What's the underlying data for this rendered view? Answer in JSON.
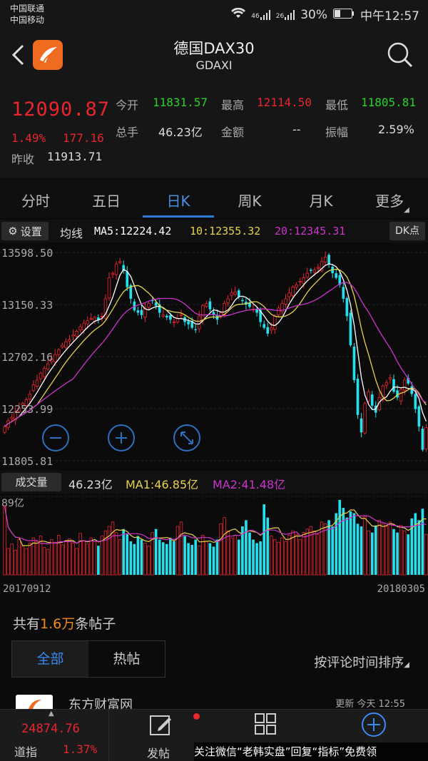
{
  "status": {
    "carrier1": "中国联通",
    "carrier2": "中国移动",
    "net1": "46",
    "net2": "26",
    "battery": "30%",
    "time": "中午12:57"
  },
  "header": {
    "title": "德国DAX30",
    "code": "GDAXI"
  },
  "quote": {
    "price": "12090.87",
    "change_pct": "1.49%",
    "change": "177.16",
    "prev_close_label": "昨收",
    "prev_close": "11913.71",
    "open_label": "今开",
    "open": "11831.57",
    "high_label": "最高",
    "high": "12114.50",
    "low_label": "最低",
    "low": "11805.81",
    "volume_label": "总手",
    "volume": "46.23亿",
    "amount_label": "金额",
    "amount": "--",
    "amplitude_label": "振幅",
    "amplitude": "2.59%"
  },
  "tabs": [
    "分时",
    "五日",
    "日K",
    "周K",
    "月K",
    "更多"
  ],
  "active_tab": "日K",
  "ma_bar": {
    "settings": "设置",
    "label": "均线",
    "ma5": "MA5:12224.42",
    "ma10": "10:12355.32",
    "ma20": "20:12345.31",
    "dk": "DK点"
  },
  "chart_data": {
    "type": "candlestick",
    "x_start": "20170912",
    "x_end": "20180305",
    "y_ticks": [
      "13598.50",
      "13150.33",
      "12702.16",
      "12253.99",
      "11805.81"
    ],
    "ylim": [
      11805.81,
      13598.5
    ],
    "closes": [
      12100,
      12150,
      12180,
      12230,
      12260,
      12300,
      12330,
      12380,
      12460,
      12500,
      12560,
      12600,
      12640,
      12680,
      12720,
      12760,
      12800,
      12830,
      12850,
      12890,
      12920,
      12960,
      12990,
      13010,
      13030,
      13040,
      13020,
      13050,
      13200,
      13380,
      13420,
      13500,
      13520,
      13440,
      13300,
      13200,
      13100,
      13080,
      13060,
      13120,
      13160,
      13180,
      13140,
      13080,
      13060,
      13040,
      13020,
      13000,
      13030,
      13060,
      13000,
      12980,
      12950,
      12930,
      13050,
      13140,
      13160,
      13110,
      13060,
      13020,
      13080,
      13160,
      13200,
      13250,
      13260,
      13220,
      13180,
      13150,
      13130,
      13110,
      13080,
      13000,
      12950,
      12900,
      12950,
      13050,
      13120,
      13160,
      13200,
      13250,
      13300,
      13320,
      13350,
      13380,
      13420,
      13440,
      13450,
      13470,
      13520,
      13560,
      13500,
      13420,
      13380,
      13320,
      13200,
      13050,
      12800,
      12500,
      12200,
      12050,
      12300,
      12400,
      12280,
      12220,
      12350,
      12450,
      12480,
      12520,
      12400,
      12350,
      12420,
      12500,
      12470,
      12380,
      12250,
      12100,
      11900,
      12090
    ],
    "volume": {
      "value": "46.23亿",
      "ma1": "MA1:46.85亿",
      "ma2": "MA2:41.48亿",
      "ymax_label": "89亿",
      "bars": [
        78,
        30,
        35,
        28,
        40,
        33,
        30,
        36,
        42,
        38,
        44,
        31,
        29,
        40,
        37,
        45,
        34,
        38,
        41,
        36,
        30,
        47,
        39,
        35,
        42,
        38,
        33,
        44,
        50,
        55,
        60,
        48,
        40,
        52,
        46,
        38,
        35,
        44,
        40,
        36,
        33,
        48,
        52,
        40,
        37,
        35,
        42,
        38,
        55,
        60,
        44,
        36,
        34,
        40,
        33,
        45,
        38,
        36,
        32,
        40,
        58,
        65,
        50,
        42,
        45,
        40,
        55,
        62,
        48,
        40,
        36,
        38,
        80,
        65,
        44,
        40,
        37,
        42,
        38,
        45,
        50,
        46,
        40,
        48,
        52,
        55,
        50,
        46,
        60,
        58,
        62,
        55,
        70,
        85,
        76,
        65,
        72,
        70,
        58,
        55,
        66,
        50,
        48,
        56,
        62,
        58,
        55,
        60,
        52,
        48,
        56,
        50,
        46,
        64,
        70,
        62,
        75,
        46
      ]
    }
  },
  "posts": {
    "prefix": "共有",
    "count": "1.6万",
    "suffix": "条帖子",
    "filter_all": "全部",
    "filter_hot": "热帖",
    "sort": "按评论时间排序"
  },
  "news": {
    "source": "东方财富网",
    "updated": "更新 今天 12:55"
  },
  "bottom": {
    "index_value": "24874.76",
    "index_name": "道指",
    "index_pct": "1.37%",
    "post": "发帖",
    "watermark": "关注微信“老韩实盘”回复“指标”免费领"
  },
  "colors": {
    "up": "#e8262e",
    "down": "#27e0ee",
    "ma5": "#ffffff",
    "ma10": "#e6d34a",
    "ma20": "#cc33cc",
    "accent": "#2a78d8"
  }
}
